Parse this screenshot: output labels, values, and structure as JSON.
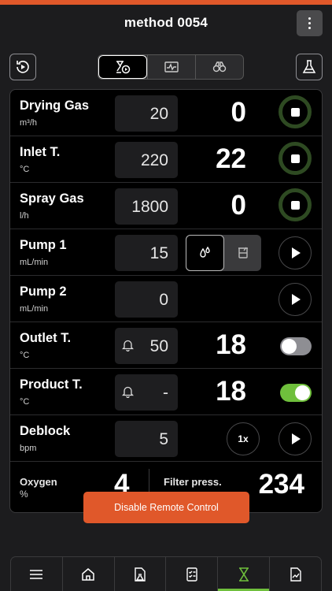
{
  "header": {
    "title": "method 0054"
  },
  "toolbar": {
    "left_icon": "history-play-icon",
    "right_icon": "flask-icon",
    "segments": [
      {
        "icon": "hourglass-play-icon",
        "active": true
      },
      {
        "icon": "waveform-chart-icon",
        "active": false
      },
      {
        "icon": "binoculars-icon",
        "active": false
      }
    ]
  },
  "rows": [
    {
      "label": "Drying Gas",
      "unit": "m³/h",
      "setpoint": "20",
      "actual": "0",
      "control": "stop"
    },
    {
      "label": "Inlet T.",
      "unit": "°C",
      "setpoint": "220",
      "actual": "22",
      "control": "stop"
    },
    {
      "label": "Spray Gas",
      "unit": "l/h",
      "setpoint": "1800",
      "actual": "0",
      "control": "stop"
    },
    {
      "label": "Pump 1",
      "unit": "mL/min",
      "setpoint": "15",
      "actual": "",
      "control": "play",
      "modes": [
        "drops-icon",
        "beaker-icon"
      ]
    },
    {
      "label": "Pump 2",
      "unit": "mL/min",
      "setpoint": "0",
      "actual": "",
      "control": "play"
    },
    {
      "label": "Outlet T.",
      "unit": "°C",
      "setpoint": "50",
      "actual": "18",
      "control": "toggle-off",
      "alarm": true
    },
    {
      "label": "Product T.",
      "unit": "°C",
      "setpoint": "-",
      "actual": "18",
      "control": "toggle-on",
      "alarm": true
    },
    {
      "label": "Deblock",
      "unit": "bpm",
      "setpoint": "5",
      "actual": "",
      "control": "play",
      "once_label": "1x"
    }
  ],
  "oxygen": {
    "label": "Oxygen",
    "unit": "%",
    "value": "4"
  },
  "filter": {
    "label": "Filter press.",
    "value": "234"
  },
  "disable_button": "Disable Remote Control",
  "tabbar": [
    {
      "icon": "menu-icon",
      "active": false
    },
    {
      "icon": "home-icon",
      "active": false
    },
    {
      "icon": "document-flask-icon",
      "active": false
    },
    {
      "icon": "checklist-icon",
      "active": false
    },
    {
      "icon": "hourglass-icon",
      "active": true
    },
    {
      "icon": "document-chart-icon",
      "active": false
    }
  ],
  "colors": {
    "accent": "#e0582a",
    "active_green": "#6fbf3c",
    "stop_ring": "#2e4a22"
  }
}
